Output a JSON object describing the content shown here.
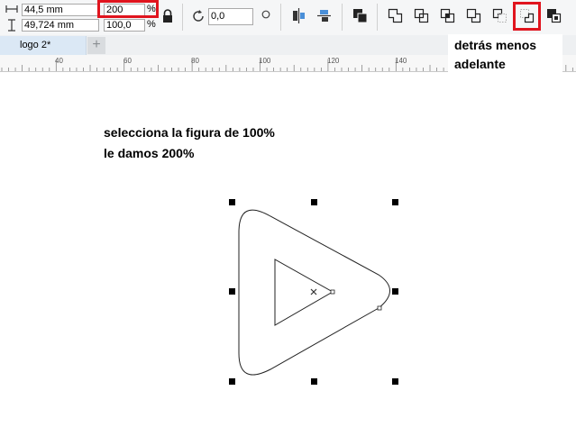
{
  "toolbar": {
    "width_value": "44,5 mm",
    "height_value": "49,724 mm",
    "scale_x_value": "200",
    "scale_y_value": "100,0",
    "percent_symbol": "%",
    "rotation_value": "0,0",
    "icons": [
      "width-icon",
      "height-icon",
      "lock-ratio-icon",
      "rotate-icon",
      "origin-icon",
      "align-icon",
      "distribute-icon",
      "combine-icon",
      "weld-icon",
      "trim-icon",
      "intersect-icon",
      "simplify-icon",
      "front-minus-back-icon",
      "back-minus-front-icon",
      "create-boundary-icon"
    ]
  },
  "document_tab": {
    "label": "logo 2*",
    "add_label": "+"
  },
  "ruler": {
    "labels": [
      "40",
      "60",
      "80",
      "100",
      "120",
      "140"
    ]
  },
  "callout": {
    "line1": "detrás menos",
    "line2": "adelante"
  },
  "instructions": {
    "line1": "selecciona la figura de 100%",
    "line2": "le damos 200%"
  },
  "colors": {
    "highlight": "#e0141e",
    "tab": "#dbe8f5",
    "toolbar": "#f5f6f7"
  }
}
